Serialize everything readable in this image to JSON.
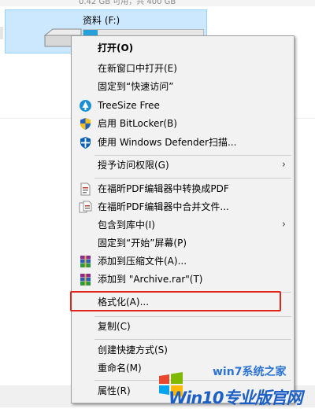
{
  "explorer": {
    "cut_text": "0.42 GB 可用，共 400 GB",
    "drive_name": "资料 (F:)",
    "drive_used_fraction": 0.12
  },
  "menu": {
    "items": [
      {
        "label": "打开(O)",
        "bold": true
      },
      {
        "label": "在新窗口中打开(E)"
      },
      {
        "label": "固定到“快速访问”"
      },
      {
        "label": "TreeSize Free",
        "icon": "treesize-icon"
      },
      {
        "label": "启用 BitLocker(B)",
        "icon": "shield-icon"
      },
      {
        "label": "使用 Windows Defender扫描...",
        "icon": "defender-icon"
      },
      {
        "label": "授予访问权限(G)",
        "submenu": true
      },
      {
        "label": "在福昕PDF编辑器中转换成PDF",
        "icon": "pdf-convert-icon"
      },
      {
        "label": "在福昕PDF编辑器中合并文件...",
        "icon": "pdf-merge-icon"
      },
      {
        "label": "包含到库中(I)",
        "submenu": true
      },
      {
        "label": "固定到“开始”屏幕(P)"
      },
      {
        "label": "添加到压缩文件(A)...",
        "icon": "winrar-icon"
      },
      {
        "label": "添加到 \"Archive.rar\"(T)",
        "icon": "winrar-icon"
      },
      {
        "label": "格式化(A)...",
        "highlighted": true
      },
      {
        "label": "复制(C)"
      },
      {
        "label": "创建快捷方式(S)"
      },
      {
        "label": "重命名(M)"
      },
      {
        "label": "属性(R)"
      }
    ],
    "arrow_glyph": "›",
    "highlight_color": "#e2231a"
  },
  "watermark": {
    "line1": "win7系统之家",
    "line2": "Win10专业版官网"
  }
}
